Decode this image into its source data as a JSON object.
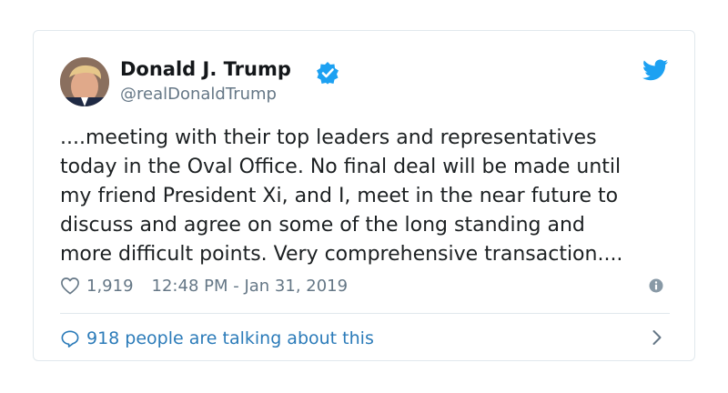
{
  "tweet": {
    "author_name": "Donald J. Trump",
    "author_handle": "@realDonaldTrump",
    "text": "....meeting with their top leaders and representatives\ntoday in the Oval Office. No final deal will be made until\nmy friend President Xi, and I, meet in the near future to\ndiscuss and agree on some of the long standing and\nmore difficult points. Very comprehensive transaction....",
    "like_count": "1,919",
    "timestamp": "12:48 PM - Jan 31, 2019",
    "talking_label": "918 people are talking about this"
  },
  "icons": {
    "verified": "verified-badge-icon",
    "brand": "twitter-bird-icon",
    "like": "heart-icon",
    "info": "info-icon",
    "talking": "speech-bubble-icon",
    "chevron": "chevron-right-icon"
  },
  "colors": {
    "brand_blue": "#1da1f2",
    "link_blue": "#2b7bb9",
    "text_dark": "#1c2022",
    "text_muted": "#657786",
    "border": "#e1e8ed"
  }
}
